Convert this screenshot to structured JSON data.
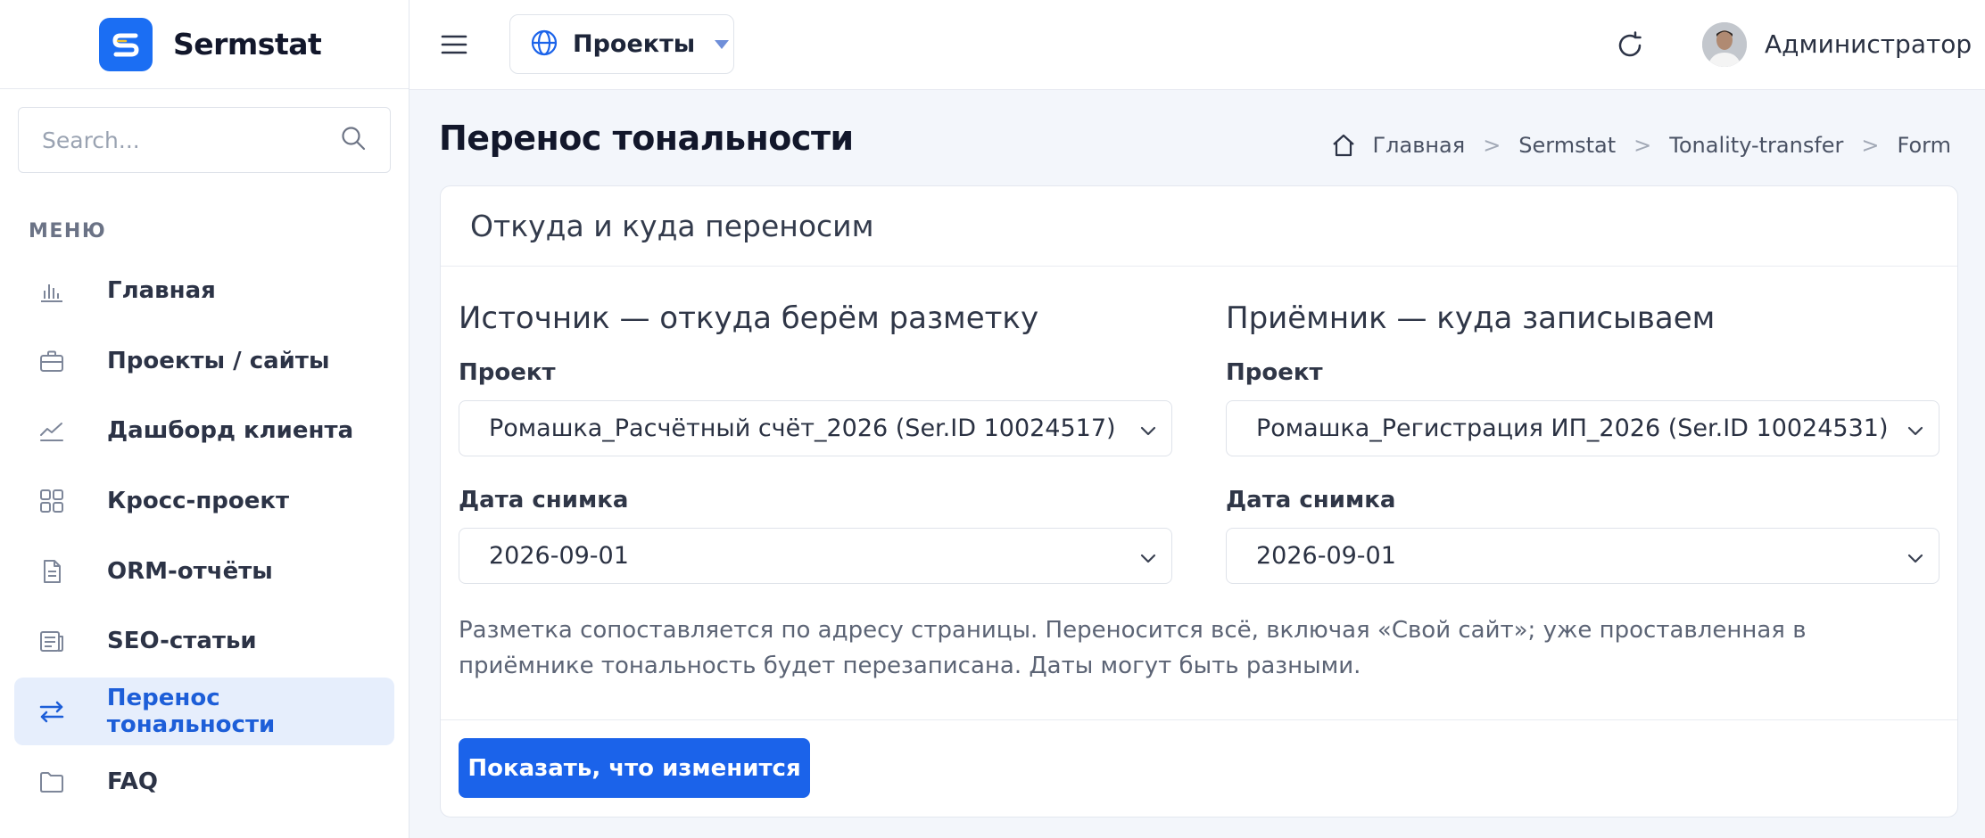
{
  "app": {
    "name": "Sermstat"
  },
  "search": {
    "placeholder": "Search..."
  },
  "sidebar": {
    "heading": "МЕНЮ",
    "items": [
      {
        "label": "Главная",
        "icon": "bar-chart-icon"
      },
      {
        "label": "Проекты / сайты",
        "icon": "briefcase-icon"
      },
      {
        "label": "Дашборд клиента",
        "icon": "line-chart-icon"
      },
      {
        "label": "Кросс-проект",
        "icon": "grid-icon"
      },
      {
        "label": "ORM-отчёты",
        "icon": "document-icon"
      },
      {
        "label": "SEO-статьи",
        "icon": "article-icon"
      },
      {
        "label": "Перенос тональности",
        "icon": "transfer-arrows-icon",
        "active": true
      },
      {
        "label": "FAQ",
        "icon": "folder-icon"
      }
    ]
  },
  "header": {
    "projects_label": "Проекты",
    "user_name": "Администратор"
  },
  "page": {
    "title": "Перенос тональности",
    "breadcrumb": [
      "Главная",
      "Sermstat",
      "Tonality-transfer",
      "Form"
    ]
  },
  "card": {
    "title": "Откуда и куда переносим",
    "source": {
      "title": "Источник — откуда берём разметку",
      "project_label": "Проект",
      "project_value": "Ромашка_Расчётный счёт_2026 (Ser.ID 10024517)",
      "date_label": "Дата снимка",
      "date_value": "2026-09-01"
    },
    "target": {
      "title": "Приёмник — куда записываем",
      "project_label": "Проект",
      "project_value": "Ромашка_Регистрация ИП_2026 (Ser.ID 10024531)",
      "date_label": "Дата снимка",
      "date_value": "2026-09-01"
    },
    "note": "Разметка сопоставляется по адресу страницы. Переносится всё, включая «Свой сайт»; уже проставленная в приёмнике тональность будет перезаписана. Даты могут быть разными.",
    "submit_label": "Показать, что изменится"
  },
  "colors": {
    "accent": "#1b63ea",
    "active_bg": "#e6eefc",
    "page_bg": "#f3f6fb"
  }
}
